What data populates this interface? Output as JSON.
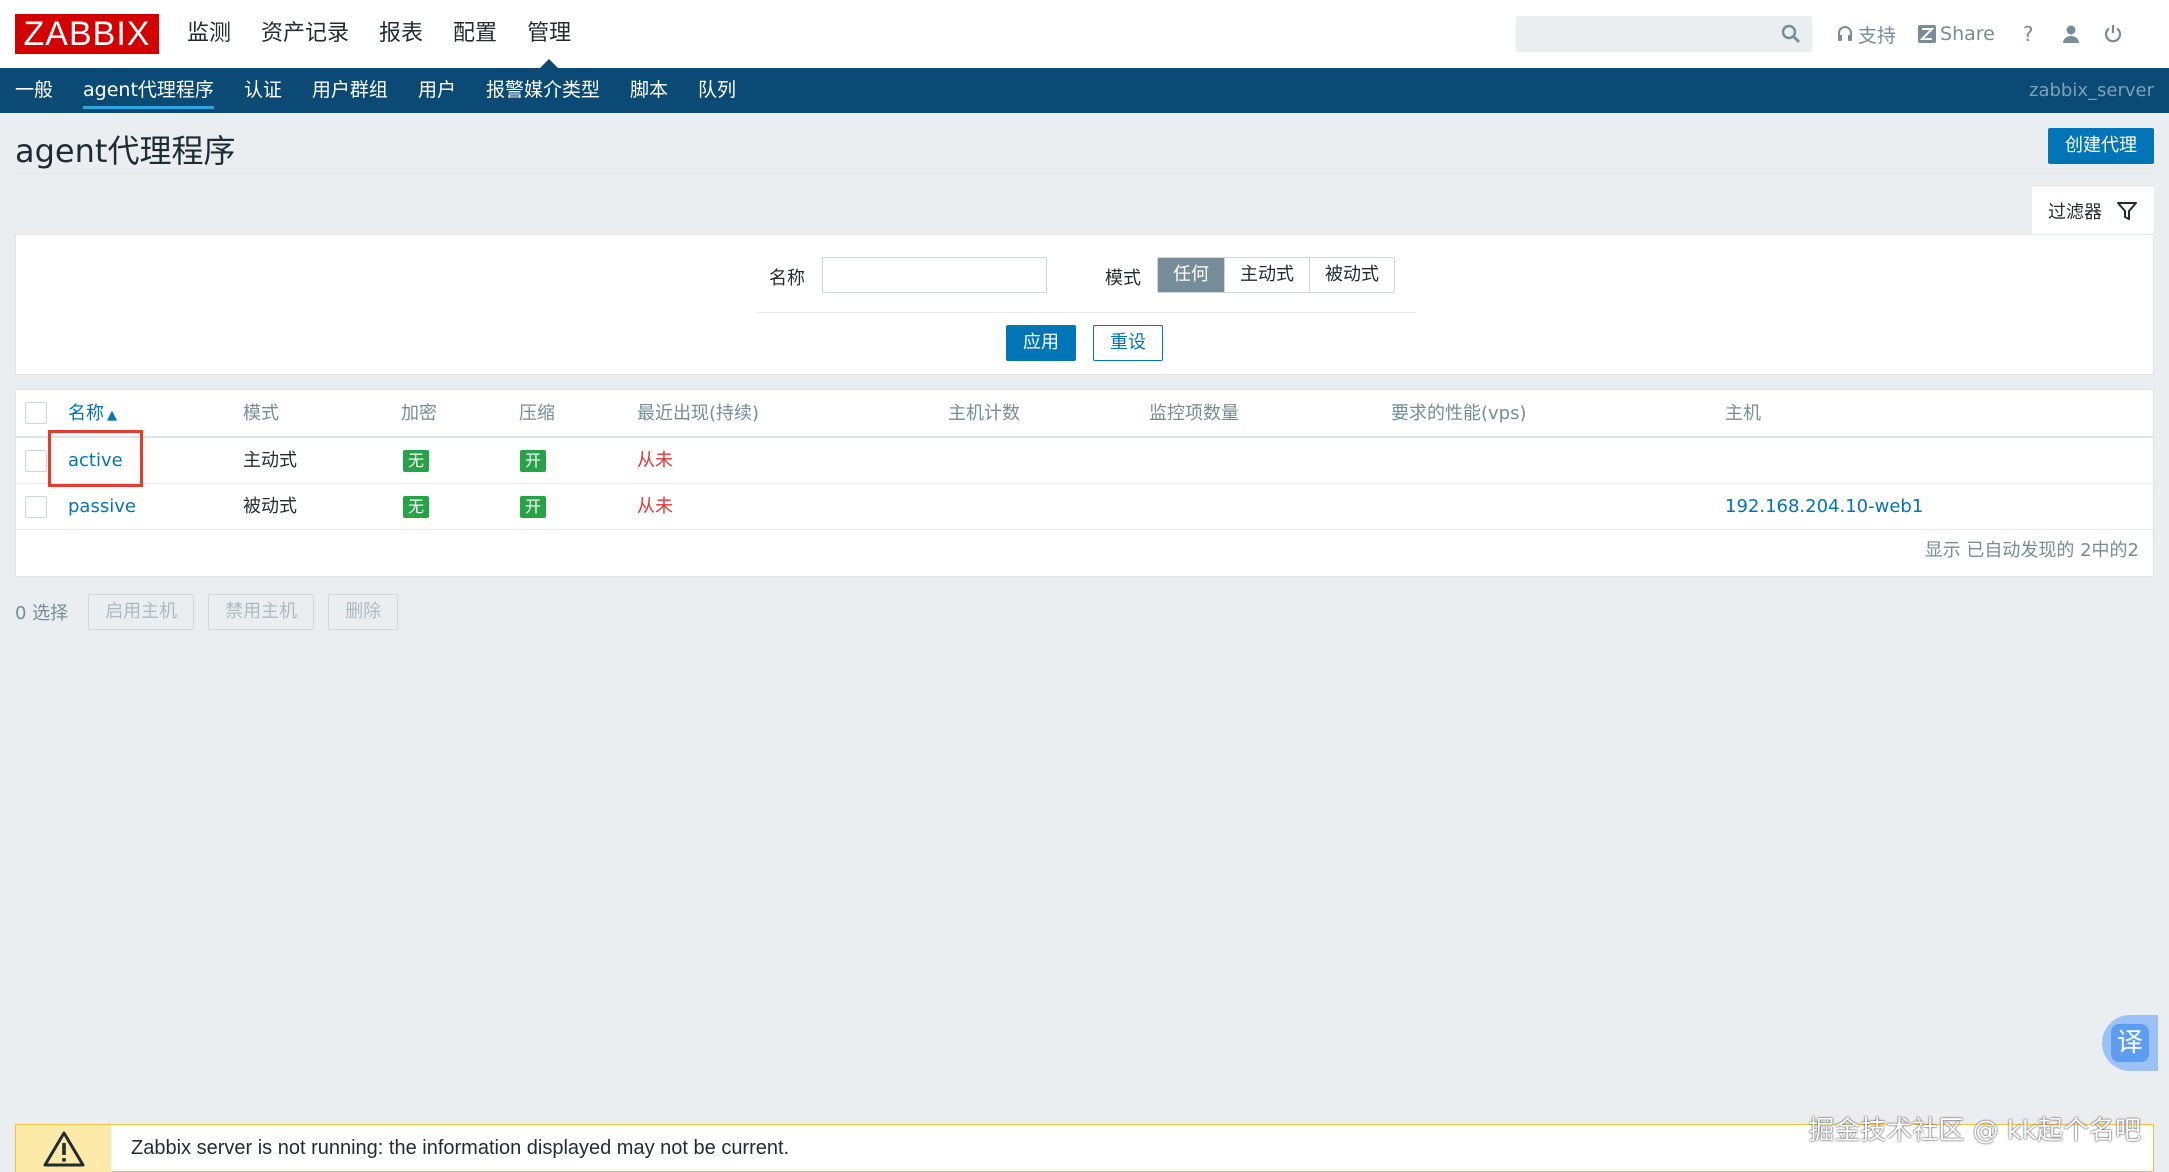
{
  "header": {
    "logo": "ZABBIX",
    "menu": [
      "监测",
      "资产记录",
      "报表",
      "配置",
      "管理"
    ],
    "selected_menu": "管理",
    "search_value": "",
    "support_label": "支持",
    "share_label": "Share",
    "help_label": "?"
  },
  "subnav": {
    "items": [
      "一般",
      "agent代理程序",
      "认证",
      "用户群组",
      "用户",
      "报警媒介类型",
      "脚本",
      "队列"
    ],
    "selected": "agent代理程序",
    "server_name": "zabbix_server"
  },
  "page": {
    "title": "agent代理程序",
    "create_button": "创建代理"
  },
  "filter": {
    "tab_label": "过滤器",
    "name_label": "名称",
    "name_value": "",
    "mode_label": "模式",
    "mode_options": [
      "任何",
      "主动式",
      "被动式"
    ],
    "mode_selected": "任何",
    "apply_label": "应用",
    "reset_label": "重设"
  },
  "table": {
    "columns": [
      "名称",
      "模式",
      "加密",
      "压缩",
      "最近出现(持续)",
      "主机计数",
      "监控项数量",
      "要求的性能(vps)",
      "主机"
    ],
    "sort_indicator": "▲",
    "rows": [
      {
        "name": "active",
        "mode": "主动式",
        "encryption": "无",
        "compression": "开",
        "last_seen": "从未",
        "host_count": "",
        "item_count": "",
        "vps": "",
        "hosts": ""
      },
      {
        "name": "passive",
        "mode": "被动式",
        "encryption": "无",
        "compression": "开",
        "last_seen": "从未",
        "host_count": "",
        "item_count": "",
        "vps": "",
        "hosts": "192.168.204.10-web1"
      }
    ],
    "footer": "显示 已自动发现的 2中的2"
  },
  "mass_actions": {
    "selected_count": "0 选择",
    "buttons": [
      "启用主机",
      "禁用主机",
      "删除"
    ]
  },
  "translate_label": "译",
  "warning": {
    "message": "Zabbix server is not running: the information displayed may not be current."
  },
  "watermark": "掘金技术社区 @ kk起个名吧",
  "colors": {
    "brand_red": "#d40000",
    "nav_blue": "#0b4a74",
    "link_blue": "#0275b8",
    "tag_green": "#26a247",
    "never_red": "#e33734",
    "highlight_red": "#e53c2f"
  }
}
